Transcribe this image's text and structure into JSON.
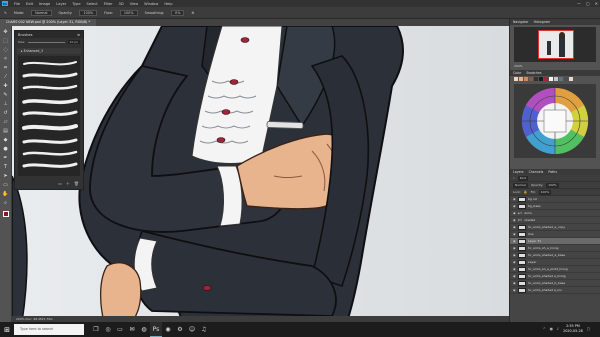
{
  "app": {
    "logo_text": "Ps",
    "menu": [
      "File",
      "Edit",
      "Image",
      "Layer",
      "Type",
      "Select",
      "Filter",
      "3D",
      "View",
      "Window",
      "Help"
    ],
    "window_controls": [
      "—",
      "▢",
      "✕"
    ]
  },
  "options": {
    "mode_label": "Mode:",
    "mode_value": "Normal",
    "opacity_label": "Opacity:",
    "opacity_value": "100%",
    "flow_label": "Flow:",
    "flow_value": "100%",
    "smoothing_label": "Smoothing:",
    "smoothing_value": "0%"
  },
  "document": {
    "tab_title": "ChARS 002 NEW.psd @ 200% (Layer 31, RGB/8) *"
  },
  "brushes_panel": {
    "title": "Brushes",
    "size_label": "Size:",
    "size_value": "10 px",
    "folder_label": "Enhanced_3"
  },
  "navigator": {
    "tabs": [
      "Navigator",
      "Histogram"
    ],
    "zoom": "200%"
  },
  "color_panel": {
    "tabs": [
      "Color",
      "Swatches"
    ]
  },
  "layers_panel": {
    "tabs": [
      "Layers",
      "Channels",
      "Paths"
    ],
    "kind_label": "Kind",
    "blend_mode": "Normal",
    "opacity_label": "Opacity:",
    "opacity_value": "100%",
    "lock_label": "Lock:",
    "fill_label": "Fill:",
    "fill_value": "100%",
    "layers": [
      {
        "name": "bg col",
        "selected": false
      },
      {
        "name": "bg_base",
        "selected": false
      },
      {
        "name": "arms",
        "selected": false
      },
      {
        "name": "shaded",
        "selected": false
      },
      {
        "name": "hc_arms_shaded_a_copy",
        "selected": false
      },
      {
        "name": "line",
        "selected": false
      },
      {
        "name": "Layer 31",
        "selected": true
      },
      {
        "name": "hc_arms_sh_a_lining",
        "selected": false
      },
      {
        "name": "hc_arms_shaded_a_base",
        "selected": false
      },
      {
        "name": "Layer",
        "selected": false
      },
      {
        "name": "hc_arms_sh_a_pinkt_lining",
        "selected": false
      },
      {
        "name": "hc_arms_shaded a_lining",
        "selected": false
      },
      {
        "name": "hc_arms_shaded_b_base",
        "selected": false
      },
      {
        "name": "hc_arms_shaded a_inv",
        "selected": false
      }
    ]
  },
  "status": {
    "text": "200%     Doc: 48.4M/1.70G"
  },
  "taskbar": {
    "search_placeholder": "Type here to search",
    "time": "2:55 PM",
    "date": "2020-05-28"
  },
  "colors": {
    "suit": "#2c3139",
    "shirt": "#f4f4f4",
    "skin": "#e8b48e",
    "accent": "#8a1a1a"
  }
}
